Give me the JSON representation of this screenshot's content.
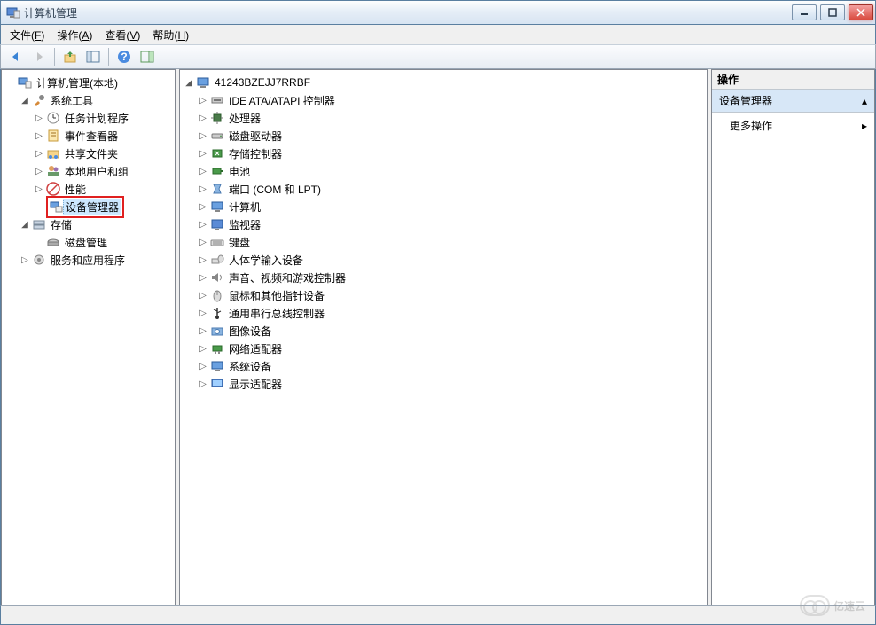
{
  "window": {
    "title": "计算机管理"
  },
  "menubar": {
    "file": {
      "label": "文件",
      "accel": "F"
    },
    "action": {
      "label": "操作",
      "accel": "A"
    },
    "view": {
      "label": "查看",
      "accel": "V"
    },
    "help": {
      "label": "帮助",
      "accel": "H"
    }
  },
  "left_tree": {
    "root": "计算机管理(本地)",
    "system_tools": "系统工具",
    "task_scheduler": "任务计划程序",
    "event_viewer": "事件查看器",
    "shared_folders": "共享文件夹",
    "local_users": "本地用户和组",
    "performance": "性能",
    "device_manager": "设备管理器",
    "storage": "存储",
    "disk_mgmt": "磁盘管理",
    "services_apps": "服务和应用程序"
  },
  "center_tree": {
    "root": "41243BZEJJ7RRBF",
    "ide": "IDE ATA/ATAPI 控制器",
    "cpu": "处理器",
    "disk_drives": "磁盘驱动器",
    "storage_ctrl": "存储控制器",
    "battery": "电池",
    "ports": "端口 (COM 和 LPT)",
    "computer": "计算机",
    "monitor": "监视器",
    "keyboard": "键盘",
    "hid": "人体学输入设备",
    "sound": "声音、视频和游戏控制器",
    "mouse": "鼠标和其他指针设备",
    "usb": "通用串行总线控制器",
    "imaging": "图像设备",
    "network": "网络适配器",
    "system": "系统设备",
    "display": "显示适配器"
  },
  "actions": {
    "header": "操作",
    "section": "设备管理器",
    "more": "更多操作"
  },
  "watermark": "亿速云"
}
